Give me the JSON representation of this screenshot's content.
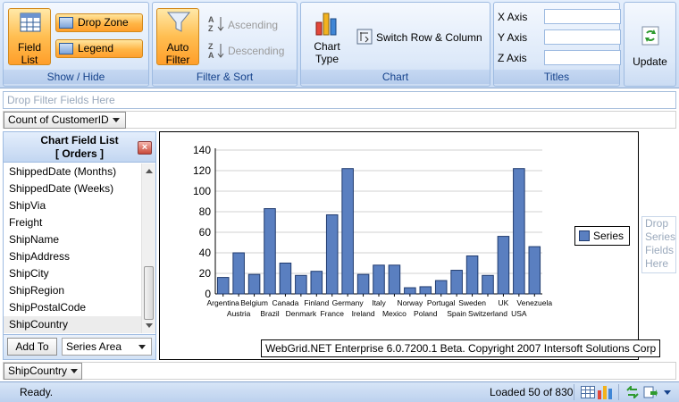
{
  "ribbon": {
    "show_hide": {
      "label": "Show / Hide",
      "field_list": "Field List",
      "drop_zone": "Drop Zone",
      "legend": "Legend"
    },
    "filter_sort": {
      "label": "Filter & Sort",
      "auto_filter": "Auto Filter",
      "ascending": "Ascending",
      "descending": "Descending"
    },
    "chart": {
      "label": "Chart",
      "chart_type": "Chart Type",
      "switch": "Switch Row & Column"
    },
    "titles": {
      "label": "Titles",
      "x_axis": "X Axis",
      "y_axis": "Y Axis",
      "z_axis": "Z Axis",
      "x_value": "",
      "y_value": "",
      "z_value": ""
    },
    "update": "Update"
  },
  "drop_filter": "Drop Filter Fields Here",
  "data_field": "Count of CustomerID",
  "field_list": {
    "title": "Chart Field List",
    "subtitle": "[ Orders ]",
    "items": [
      "ShippedDate (Months)",
      "ShippedDate (Weeks)",
      "ShipVia",
      "Freight",
      "ShipName",
      "ShipAddress",
      "ShipCity",
      "ShipRegion",
      "ShipPostalCode",
      "ShipCountry"
    ],
    "selected": "ShipCountry",
    "add_to": "Add To",
    "area": "Series Area"
  },
  "chart_data": {
    "type": "bar",
    "categories": [
      "Argentina",
      "Austria",
      "Belgium",
      "Brazil",
      "Canada",
      "Denmark",
      "Finland",
      "France",
      "Germany",
      "Ireland",
      "Italy",
      "Mexico",
      "Norway",
      "Poland",
      "Portugal",
      "Spain",
      "Sweden",
      "Switzerland",
      "UK",
      "USA",
      "Venezuela"
    ],
    "values": [
      16,
      40,
      19,
      83,
      30,
      18,
      22,
      77,
      122,
      19,
      28,
      28,
      6,
      7,
      13,
      23,
      37,
      18,
      56,
      122,
      46
    ],
    "ylim": [
      0,
      140
    ],
    "yticks": [
      0,
      20,
      40,
      60,
      80,
      100,
      120,
      140
    ],
    "grid": true,
    "legend_position": "right",
    "series": [
      {
        "name": "Series"
      }
    ],
    "color": "#5a7fc0"
  },
  "copyright": "WebGrid.NET Enterprise 6.0.7200.1 Beta. Copyright 2007 Intersoft Solutions Corp",
  "drop_series": "Drop Series Fields Here",
  "row_field": "ShipCountry",
  "status": {
    "text": "Ready.",
    "loaded": "Loaded 50 of 830"
  }
}
